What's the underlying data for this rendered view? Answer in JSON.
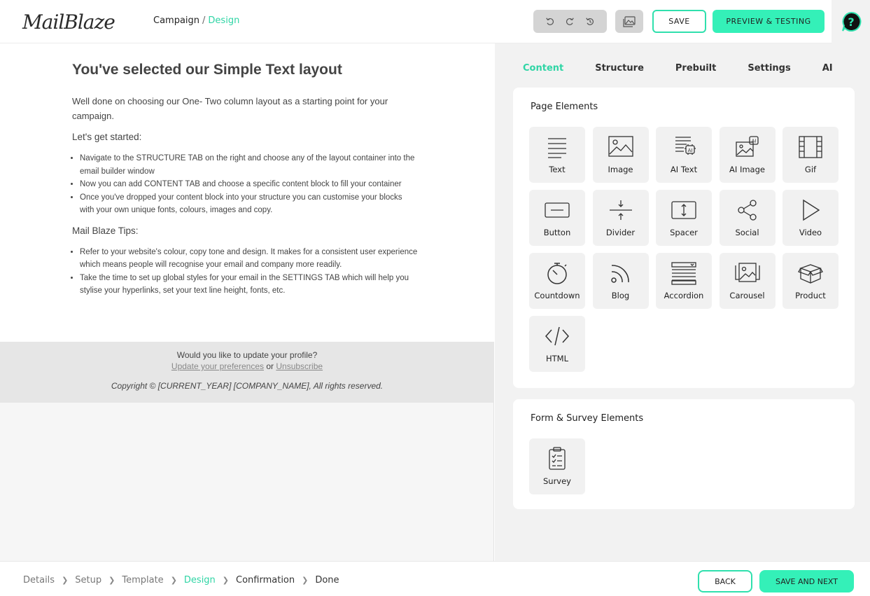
{
  "header": {
    "logo_text": "MailBlaze",
    "breadcrumb": {
      "parent": "Campaign",
      "separator": "/",
      "current": "Design"
    },
    "history_icons": [
      "undo-icon",
      "redo-icon",
      "history-icon"
    ],
    "image_button_icon": "image-gallery-icon",
    "save_label": "SAVE",
    "preview_label": "PREVIEW & TESTING",
    "help_icon": "help-icon"
  },
  "email": {
    "title": "You've selected our Simple Text layout",
    "intro": "Well done on choosing our One- Two column layout as a starting point for your campaign.",
    "section1_title": "Let's get started:",
    "section1_items": [
      "Navigate to the STRUCTURE TAB on the right and choose any of the layout container into the email builder window",
      "Now you can add CONTENT TAB and choose a specific content block to fill your container",
      "Once you've dropped your content block into your structure you can customise your blocks with your own unique fonts, colours, images and copy."
    ],
    "section2_title": "Mail Blaze Tips:",
    "section2_items": [
      "Refer to your website's colour, copy tone and design. It makes for a consistent user experience which means people will recognise your email and company more readily.",
      "Take the time to set up global styles for your email in the SETTINGS TAB which will help you stylise your hyperlinks, set your text line height, fonts, etc."
    ],
    "footer": {
      "question": "Would you like to update your profile?",
      "update_link": "Update your preferences",
      "or": "or",
      "unsubscribe_link": "Unsubscribe",
      "copyright": "Copyright © [CURRENT_YEAR] [COMPANY_NAME], All rights reserved."
    }
  },
  "panel": {
    "tabs": [
      "Content",
      "Structure",
      "Prebuilt",
      "Settings",
      "AI"
    ],
    "active_tab": "Content",
    "page_elements_title": "Page Elements",
    "page_elements": [
      {
        "label": "Text",
        "icon": "text-icon"
      },
      {
        "label": "Image",
        "icon": "image-icon"
      },
      {
        "label": "AI Text",
        "icon": "ai-text-icon"
      },
      {
        "label": "AI Image",
        "icon": "ai-image-icon"
      },
      {
        "label": "Gif",
        "icon": "gif-icon"
      },
      {
        "label": "Button",
        "icon": "button-icon"
      },
      {
        "label": "Divider",
        "icon": "divider-icon"
      },
      {
        "label": "Spacer",
        "icon": "spacer-icon"
      },
      {
        "label": "Social",
        "icon": "social-icon"
      },
      {
        "label": "Video",
        "icon": "video-icon"
      },
      {
        "label": "Countdown",
        "icon": "countdown-icon"
      },
      {
        "label": "Blog",
        "icon": "blog-icon"
      },
      {
        "label": "Accordion",
        "icon": "accordion-icon"
      },
      {
        "label": "Carousel",
        "icon": "carousel-icon"
      },
      {
        "label": "Product",
        "icon": "product-icon"
      },
      {
        "label": "HTML",
        "icon": "html-icon"
      }
    ],
    "form_title": "Form & Survey Elements",
    "form_elements": [
      {
        "label": "Survey",
        "icon": "survey-icon"
      }
    ]
  },
  "bottom": {
    "steps": [
      "Details",
      "Setup",
      "Template",
      "Design",
      "Confirmation",
      "Done"
    ],
    "active_step": "Design",
    "back_label": "BACK",
    "next_label": "SAVE AND NEXT"
  },
  "colors": {
    "accent": "#34f0b8",
    "accent_text": "#2fd5a5"
  }
}
